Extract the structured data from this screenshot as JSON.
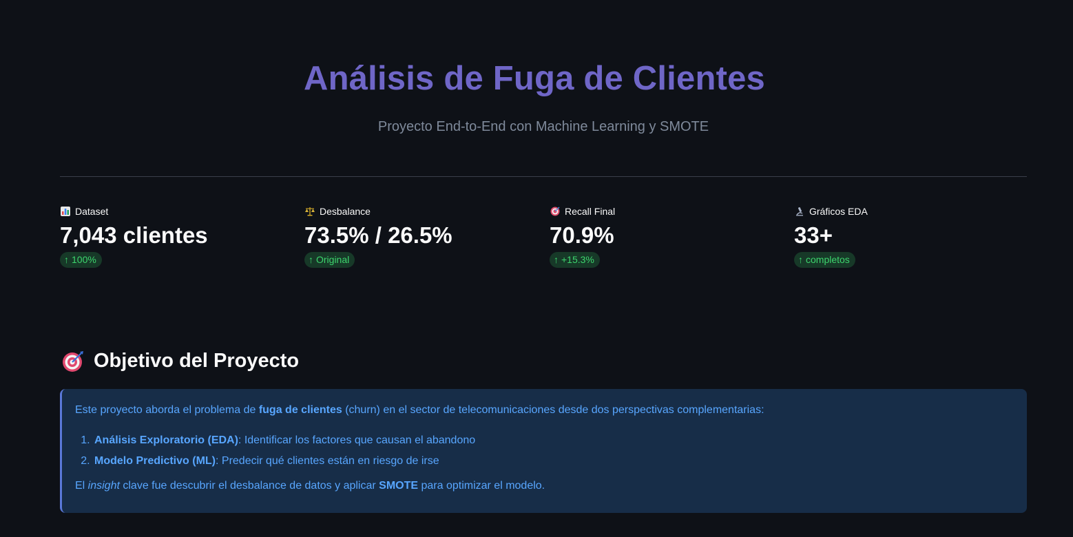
{
  "hero": {
    "title": "Análisis de Fuga de Clientes",
    "subtitle": "Proyecto End-to-End con Machine Learning y SMOTE"
  },
  "metrics": [
    {
      "icon": "bar-chart-icon",
      "label": "Dataset",
      "value": "7,043 clientes",
      "delta": "100%"
    },
    {
      "icon": "balance-scale-icon",
      "label": "Desbalance",
      "value": "73.5% / 26.5%",
      "delta": "Original"
    },
    {
      "icon": "target-icon",
      "label": "Recall Final",
      "value": "70.9%",
      "delta": "+15.3%"
    },
    {
      "icon": "microscope-icon",
      "label": "Gráficos EDA",
      "value": "33+",
      "delta": "completos"
    }
  ],
  "colors": {
    "background": "#0e1117",
    "title": "#6f66c7",
    "delta_bg": "#173928",
    "delta_text": "#3dd56d",
    "info_bg": "#172d48",
    "info_text": "#58a6ff"
  },
  "objective": {
    "title": "Objetivo del Proyecto",
    "intro_1": "Este proyecto aborda el problema de ",
    "intro_bold": "fuga de clientes",
    "intro_2": " (churn) en el sector de telecomunicaciones desde dos perspectivas complementarias:",
    "items": [
      {
        "bold": "Análisis Exploratorio (EDA)",
        "text": ": Identificar los factores que causan el abandono"
      },
      {
        "bold": "Modelo Predictivo (ML)",
        "text": ": Predecir qué clientes están en riesgo de irse"
      }
    ],
    "closing_1": "El ",
    "closing_italic": "insight",
    "closing_2": " clave fue descubrir el desbalance de datos y aplicar ",
    "closing_bold": "SMOTE",
    "closing_3": " para optimizar el modelo."
  }
}
